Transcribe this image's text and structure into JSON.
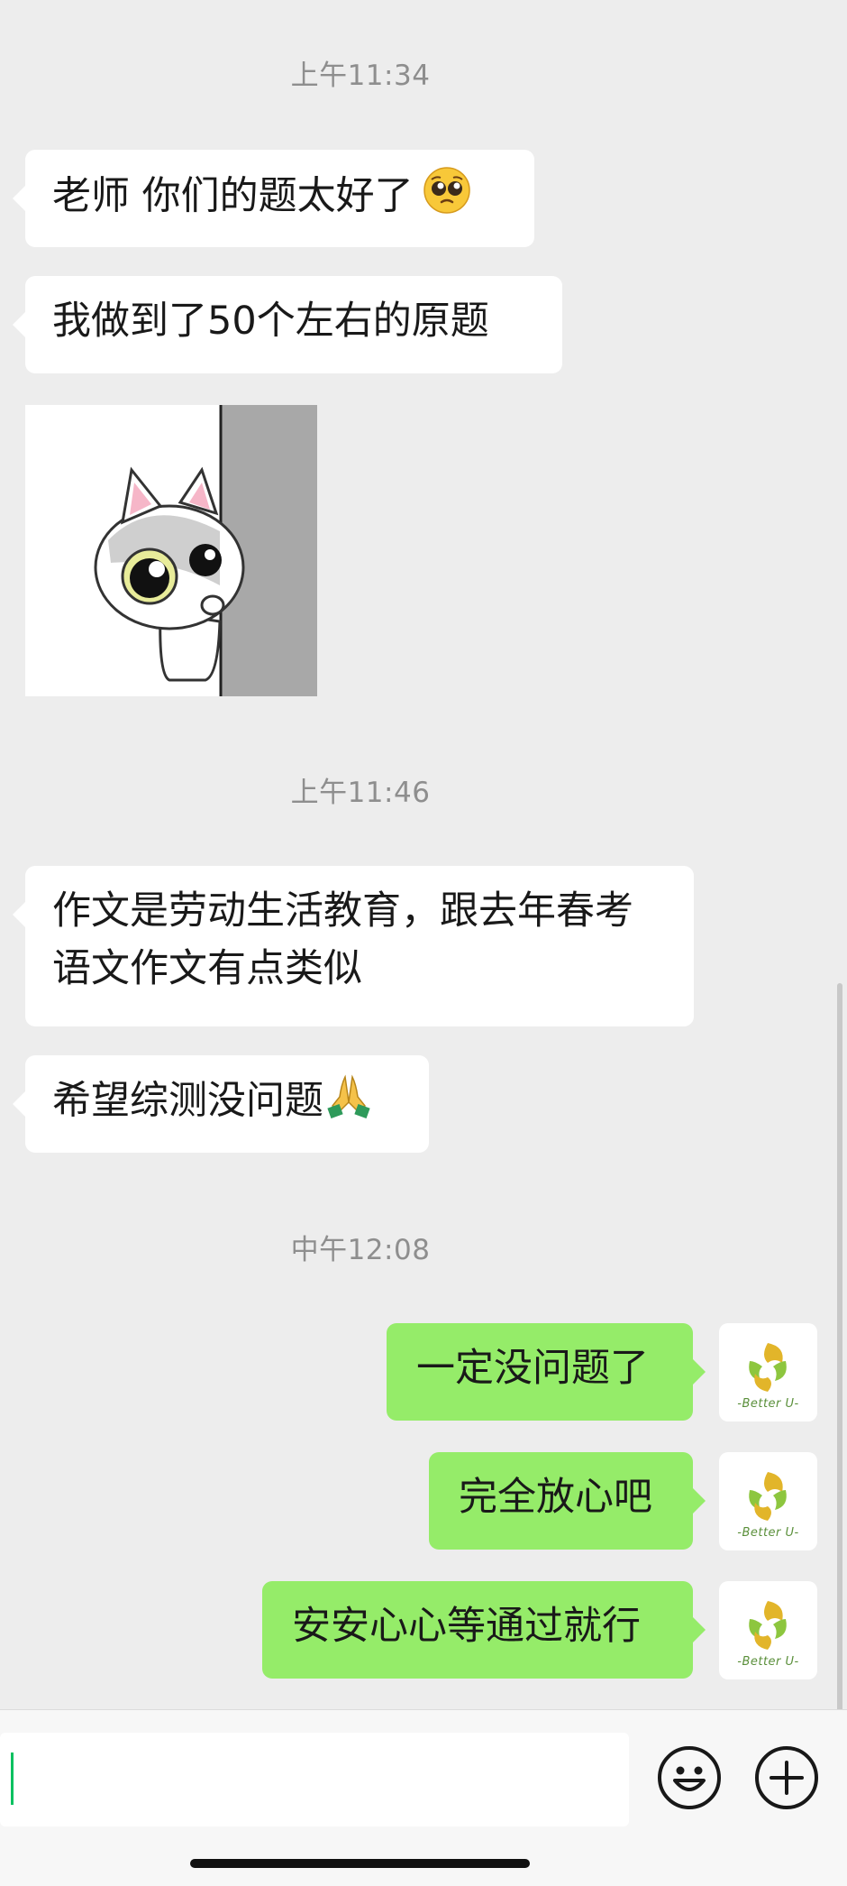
{
  "chat": {
    "timestamps": [
      "上午11:34",
      "上午11:46",
      "中午12:08"
    ],
    "incoming": [
      "老师 你们的题太好了",
      "我做到了50个左右的原题",
      "作文是劳动生活教育，跟去年春考",
      "语文作文有点类似",
      "希望综测没问题"
    ],
    "outgoing": [
      "一定没问题了",
      "完全放心吧",
      "安安心心等通过就行"
    ],
    "emojis": [
      "pleading-face-icon",
      "folded-hands-icon"
    ],
    "sticker": "peeking-cat-sticker",
    "avatar_text": "-Better U-"
  },
  "input_bar": {
    "icons": [
      "emoji-icon",
      "plus-icon"
    ],
    "caret_color": "#07c160"
  },
  "colors": {
    "background": "#ededed",
    "incoming_bubble": "#ffffff",
    "outgoing_bubble": "#95ec69"
  }
}
